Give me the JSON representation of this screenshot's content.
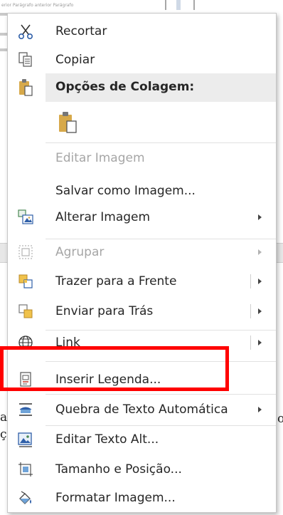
{
  "background": {
    "snippet_top": "erior Parágrafo anterior Parágrafo",
    "left_fragment_1": "a",
    "left_fragment_2": "çã",
    "right_fragment": "o"
  },
  "menu": {
    "items": [
      {
        "label": "Recortar",
        "icon": "scissors-icon",
        "enabled": true
      },
      {
        "label": "Copiar",
        "icon": "copy-icon",
        "enabled": true
      },
      {
        "label": "Opções de Colagem:",
        "icon": "clipboard-icon",
        "enabled": true
      },
      {
        "label": "Editar Imagem",
        "icon": "",
        "enabled": false
      },
      {
        "label": "Salvar como Imagem...",
        "icon": "",
        "enabled": true
      },
      {
        "label": "Alterar Imagem",
        "icon": "change-picture-icon",
        "enabled": true,
        "submenu": true
      },
      {
        "label": "Agrupar",
        "icon": "group-icon",
        "enabled": false,
        "submenu": true
      },
      {
        "label": "Trazer para a Frente",
        "icon": "bring-forward-icon",
        "enabled": true,
        "submenu": true
      },
      {
        "label": "Enviar para Trás",
        "icon": "send-backward-icon",
        "enabled": true,
        "submenu": true
      },
      {
        "label": "Link",
        "icon": "globe-link-icon",
        "enabled": true,
        "submenu": true
      },
      {
        "label": "Inserir Legenda...",
        "icon": "insert-caption-icon",
        "enabled": true
      },
      {
        "label": "Quebra de Texto Automática",
        "icon": "wrap-text-icon",
        "enabled": true,
        "submenu": true
      },
      {
        "label": "Editar Texto Alt...",
        "icon": "alt-text-icon",
        "enabled": true
      },
      {
        "label": "Tamanho e Posição...",
        "icon": "size-position-icon",
        "enabled": true
      },
      {
        "label": "Formatar Imagem...",
        "icon": "format-picture-icon",
        "enabled": true
      }
    ]
  },
  "colors": {
    "highlight": "#ff0000",
    "header_bg": "#ececec",
    "disabled_text": "#a6a6a6",
    "clipboard_tan": "#d7a94a"
  }
}
